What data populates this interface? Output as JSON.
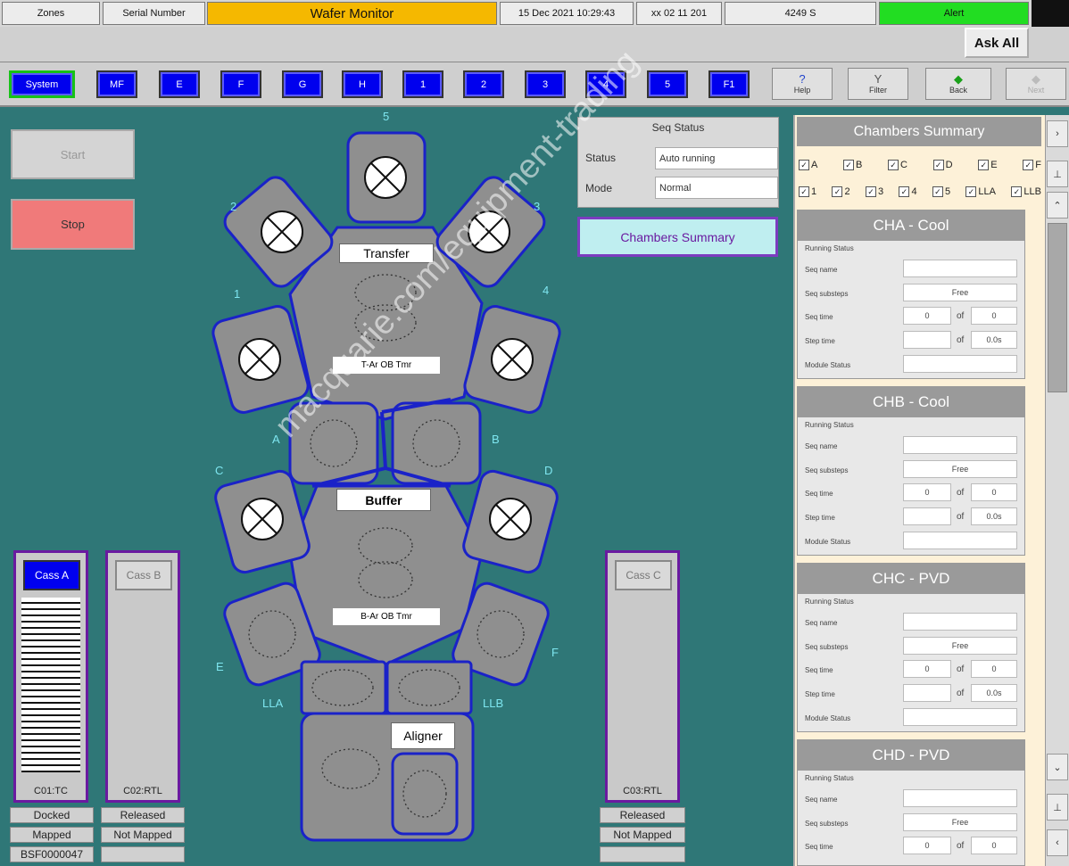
{
  "topbar": {
    "cells": [
      "Zones",
      "Serial Number",
      "Wafer Monitor",
      "15 Dec 2021 10:29:43",
      "xx 02 11 201",
      "4249 S",
      "Alert"
    ],
    "title_color": "#f5b800",
    "alert_color": "#22dd22"
  },
  "toolbar": {
    "ask_all": "Ask All"
  },
  "nav": {
    "buttons": [
      "System",
      "MF",
      "E",
      "F",
      "G",
      "H",
      "1",
      "2",
      "3",
      "4",
      "5",
      "F1"
    ],
    "tools": [
      {
        "icon": "help-icon",
        "glyph": "?",
        "label": "Help"
      },
      {
        "icon": "filter-icon",
        "glyph": "Y",
        "label": "Filter"
      },
      {
        "icon": "back-arrow-icon",
        "glyph": "◆",
        "label": "Back"
      },
      {
        "icon": "forward-arrow-icon",
        "glyph": "◆",
        "label": "Next"
      }
    ]
  },
  "controls": {
    "start": "Start",
    "stop": "Stop"
  },
  "seq_status": {
    "title": "Seq Status",
    "status_label": "Status",
    "status_value": "Auto running",
    "mode_label": "Mode",
    "mode_value": "Normal"
  },
  "chambers_summary_button": "Chambers Summary",
  "diagram": {
    "transfer": "Transfer",
    "buffer": "Buffer",
    "aligner": "Aligner",
    "transfer_robot": "T-Ar OB Tmr",
    "buffer_robot": "B-Ar OB Tmr",
    "labels": {
      "n5": "5",
      "n2": "2",
      "n3": "3",
      "n1": "1",
      "n4": "4",
      "A": "A",
      "B": "B",
      "C": "C",
      "D": "D",
      "E": "E",
      "F": "F",
      "LLA": "LLA",
      "LLB": "LLB"
    }
  },
  "cassettes": [
    {
      "button": "Cass A",
      "id": "C01:TC",
      "active": true,
      "status1": "Docked",
      "status2": "Mapped",
      "status3": "BSF0000047"
    },
    {
      "button": "Cass B",
      "id": "C02:RTL",
      "active": false,
      "status1": "Released",
      "status2": "Not Mapped",
      "status3": ""
    },
    {
      "button": "Cass C",
      "id": "C03:RTL",
      "active": false,
      "status1": "Released",
      "status2": "Not Mapped",
      "status3": ""
    }
  ],
  "summary": {
    "title": "Chambers Summary",
    "checks_row1": [
      "A",
      "B",
      "C",
      "D",
      "E",
      "F"
    ],
    "checks_row2": [
      "1",
      "2",
      "3",
      "4",
      "5",
      "LLA",
      "LLB"
    ],
    "chambers": [
      {
        "title": "CHA - Cool",
        "section": "Running Status",
        "labels": [
          "Seq name",
          "Seq substeps",
          "Seq time",
          "Step time",
          "Module Status"
        ],
        "val_substep": "Free",
        "time1": "0",
        "of": "of",
        "time2": "0",
        "time3": "0.0s"
      },
      {
        "title": "CHB - Cool",
        "section": "Running Status",
        "labels": [
          "Seq name",
          "Seq substeps",
          "Seq time",
          "Step time",
          "Module Status"
        ],
        "val_substep": "Free",
        "time1": "0",
        "of": "of",
        "time2": "0",
        "time3": "0.0s"
      },
      {
        "title": "CHC - PVD",
        "section": "Running Status",
        "labels": [
          "Seq name",
          "Seq substeps",
          "Seq time",
          "Step time",
          "Module Status"
        ],
        "val_substep": "Free",
        "time1": "0",
        "of": "of",
        "time2": "0",
        "time3": "0.0s"
      },
      {
        "title": "CHD - PVD",
        "section": "Running Status",
        "labels": [
          "Seq name",
          "Seq substeps",
          "Seq time"
        ],
        "val_substep": "Free",
        "time1": "0",
        "of": "of",
        "time2": "0",
        "time3": ""
      }
    ]
  },
  "watermark": "macquarie.com/equipment-trading"
}
